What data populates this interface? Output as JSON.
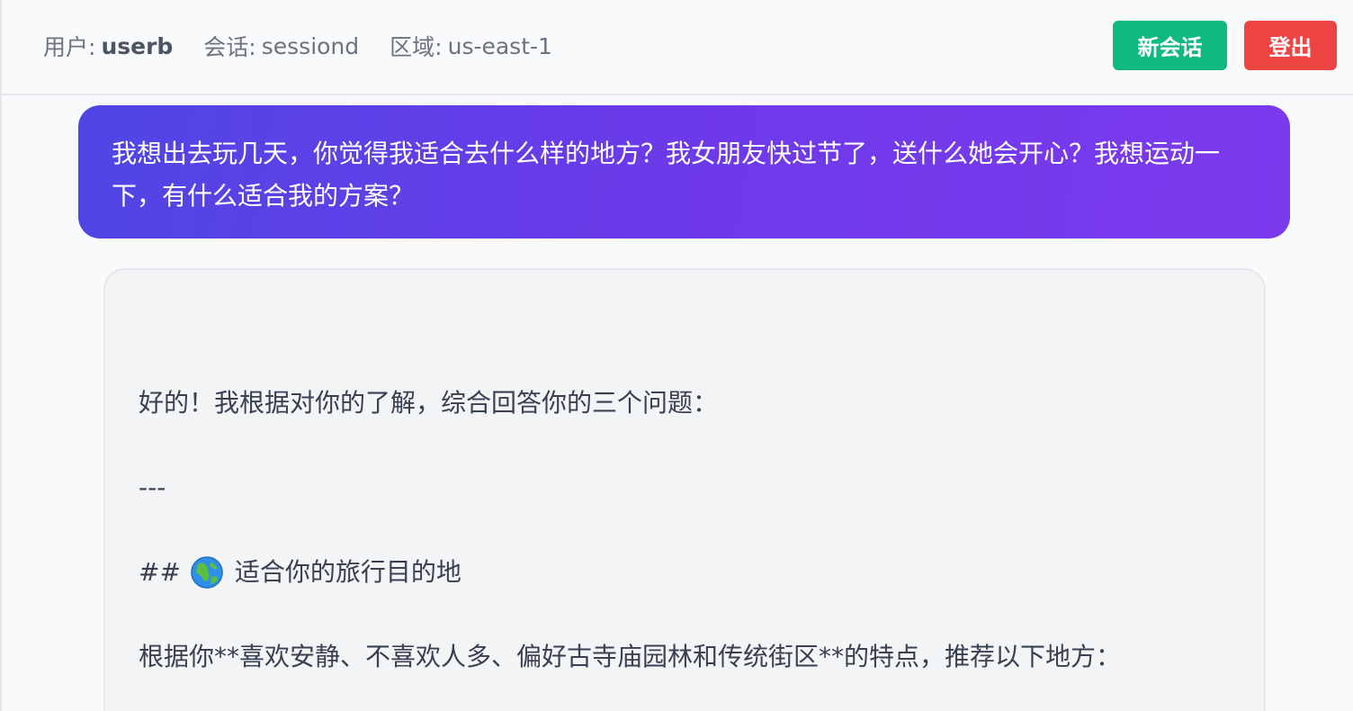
{
  "header": {
    "user_label": "用户:",
    "user_value": "userb",
    "session_label": "会话:",
    "session_value": "sessiond",
    "region_label": "区域:",
    "region_value": "us-east-1",
    "new_chat_label": "新会话",
    "logout_label": "登出"
  },
  "chat": {
    "user_message": "我想出去玩几天，你觉得我适合去什么样的地方？我女朋友快过节了，送什么她会开心？我想运动一下，有什么适合我的方案？",
    "assistant": {
      "line1": "好的！我根据对你的了解，综合回答你的三个问题：",
      "line2": "---",
      "heading_prefix": "##",
      "heading_icon": "globe-icon",
      "heading_text": "适合你的旅行目的地",
      "line4": "根据你**喜欢安静、不喜欢人多、偏好古寺庙园林和传统街区**的特点，推荐以下地方："
    }
  },
  "colors": {
    "new_chat_button": "#10b981",
    "logout_button": "#ef4444",
    "user_bubble_start": "#4f46e5",
    "user_bubble_end": "#7c3aed",
    "assistant_card": "#f3f4f6"
  }
}
